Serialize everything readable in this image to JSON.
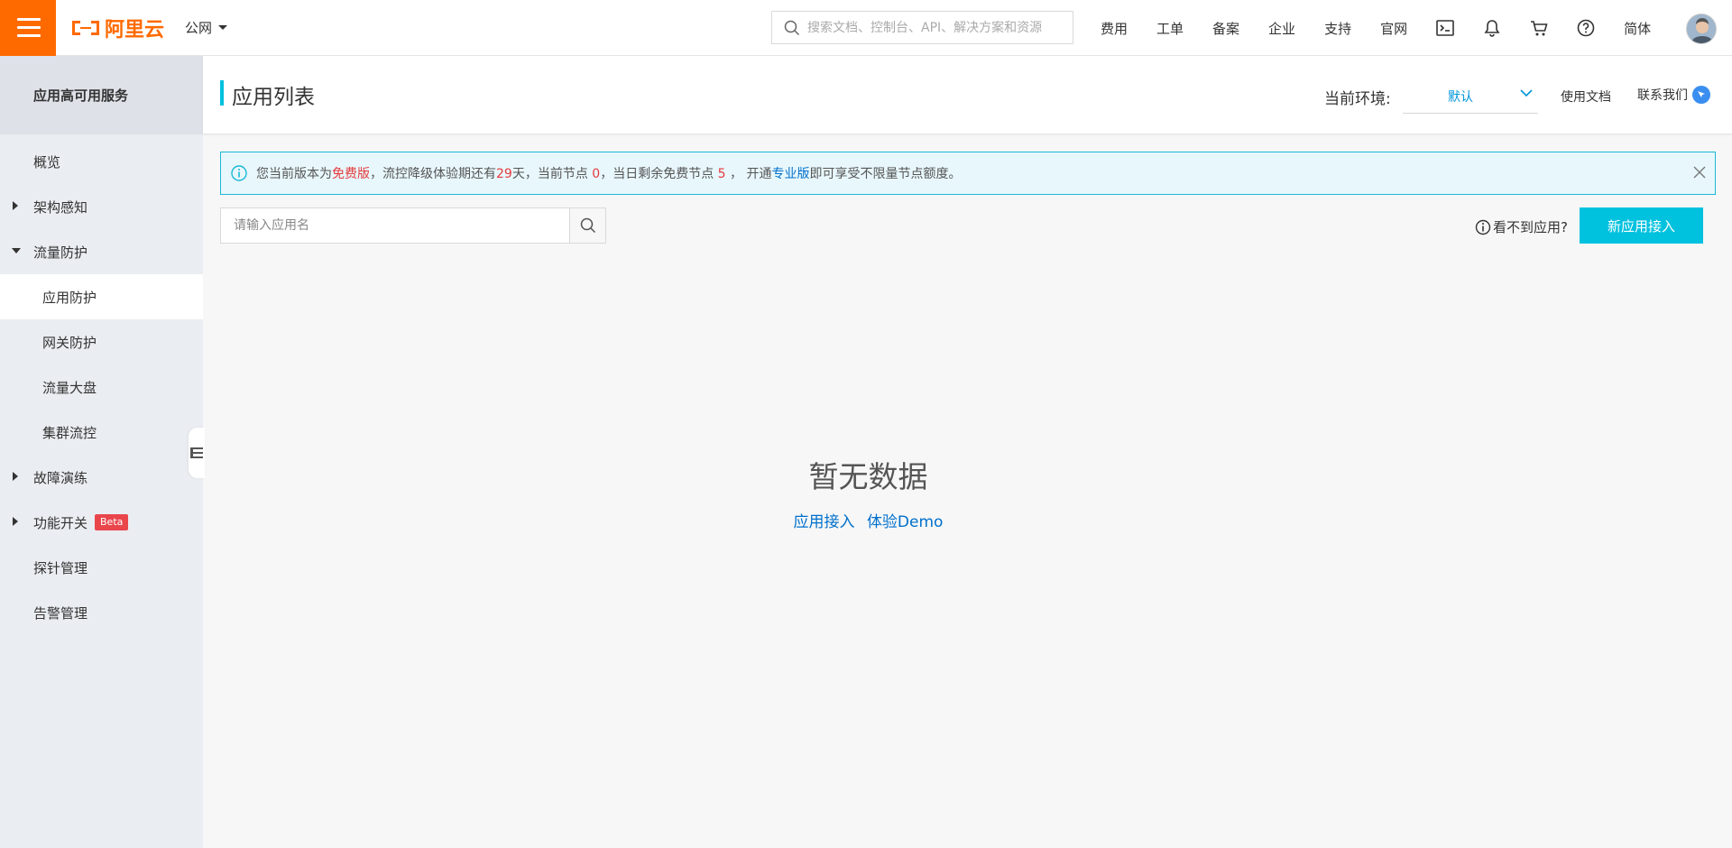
{
  "colors": {
    "brand": "#ff6a00",
    "accent": "#00c1de",
    "link": "#0070cc",
    "highlight": "#e4393c"
  },
  "topbar": {
    "logo_text": "阿里云",
    "region": "公网",
    "search_placeholder": "搜索文档、控制台、API、解决方案和资源",
    "nav": [
      "费用",
      "工单",
      "备案",
      "企业",
      "支持",
      "官网"
    ],
    "icons": [
      "terminal-icon",
      "bell-icon",
      "cart-icon",
      "help-icon"
    ],
    "lang": "简体"
  },
  "sidebar": {
    "title": "应用高可用服务",
    "items": [
      {
        "label": "概览"
      },
      {
        "label": "架构感知"
      },
      {
        "label": "流量防护"
      },
      {
        "label": "应用防护"
      },
      {
        "label": "网关防护"
      },
      {
        "label": "流量大盘"
      },
      {
        "label": "集群流控"
      },
      {
        "label": "故障演练"
      },
      {
        "label": "功能开关",
        "badge": "Beta"
      },
      {
        "label": "探针管理"
      },
      {
        "label": "告警管理"
      }
    ]
  },
  "header": {
    "title": "应用列表",
    "env_label": "当前环境:",
    "env_value": "默认",
    "doc_link": "使用文档",
    "contact_link": "联系我们"
  },
  "notice": {
    "t1": "您当前版本为",
    "edition": "免费版",
    "t2": "，流控降级体验期还有",
    "days": "29",
    "t3": "天，当前节点 ",
    "nodes": "0",
    "t4": "，当日剩余免费节点 ",
    "free_nodes": "5",
    "t5": " ， 开通",
    "pro": "专业版",
    "t6": "即可享受不限量节点额度。"
  },
  "toolbar": {
    "search_placeholder": "请输入应用名",
    "cant_see": "看不到应用?",
    "new_app": "新应用接入"
  },
  "empty": {
    "title": "暂无数据",
    "link1": "应用接入",
    "link2": "体验Demo"
  }
}
